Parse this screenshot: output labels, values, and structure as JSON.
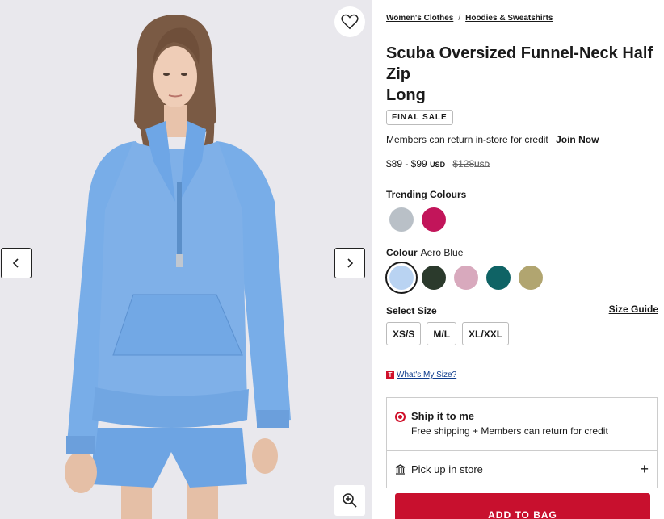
{
  "breadcrumb": [
    "Women's Clothes",
    "Hoodies & Sweatshirts"
  ],
  "breadcrumb_sep": "/",
  "product": {
    "title_line1": "Scuba Oversized Funnel-Neck Half",
    "title_line2": "Zip",
    "title_line3": "Long",
    "badge": "FINAL SALE",
    "members_text": "Members can return in-store for credit",
    "join_label": "Join Now",
    "price_range": "$89 - $99",
    "currency": "USD",
    "original_price": "$128",
    "original_currency": "USD"
  },
  "trending": {
    "label": "Trending Colours",
    "swatches": [
      {
        "name": "grey",
        "color": "#b9c0c7"
      },
      {
        "name": "magenta",
        "color": "#c2155a"
      }
    ]
  },
  "colour": {
    "label": "Colour",
    "selected_name": "Aero Blue",
    "swatches": [
      {
        "name": "aero-blue",
        "color": "#b9d3f2"
      },
      {
        "name": "dark-green",
        "color": "#2b3a2c"
      },
      {
        "name": "pink",
        "color": "#d8a9bd"
      },
      {
        "name": "teal",
        "color": "#0f6365"
      },
      {
        "name": "olive",
        "color": "#b1a570"
      }
    ]
  },
  "size": {
    "label": "Select Size",
    "guide_label": "Size Guide",
    "options": [
      "XS/S",
      "M/L",
      "XL/XXL"
    ],
    "fit_link": "What's My Size?",
    "fit_icon": "T"
  },
  "delivery": {
    "ship_title": "Ship it to me",
    "ship_sub": "Free shipping + Members can return for credit",
    "pickup_title": "Pick up in store",
    "pickup_action": "+"
  },
  "cta": {
    "add_to_bag": "ADD TO BAG"
  },
  "colors": {
    "accent": "#c8102e",
    "garment": "#7fb0e8"
  }
}
